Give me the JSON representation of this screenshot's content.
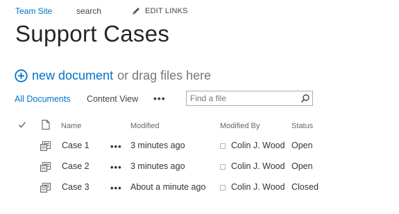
{
  "top_nav": {
    "team_site": "Team Site",
    "search": "search",
    "edit_links": "EDIT LINKS"
  },
  "page": {
    "title": "Support Cases"
  },
  "new_document": {
    "link": "new document",
    "drag_text": "or drag files here"
  },
  "views": {
    "all_documents": "All Documents",
    "content_view": "Content View",
    "more": "•••"
  },
  "find": {
    "placeholder": "Find a file",
    "value": ""
  },
  "table": {
    "headers": {
      "name": "Name",
      "modified": "Modified",
      "modified_by": "Modified By",
      "status": "Status"
    },
    "rows": [
      {
        "name": "Case 1",
        "menu": "•••",
        "modified": "3 minutes ago",
        "modified_by": "Colin J. Wood",
        "status": "Open"
      },
      {
        "name": "Case 2",
        "menu": "•••",
        "modified": "3 minutes ago",
        "modified_by": "Colin J. Wood",
        "status": "Open"
      },
      {
        "name": "Case 3",
        "menu": "•••",
        "modified": "About a minute ago",
        "modified_by": "Colin J. Wood",
        "status": "Closed"
      }
    ]
  },
  "colors": {
    "accent": "#0072c6",
    "text": "#333333",
    "muted": "#777777"
  },
  "icons": {
    "edit": "pencil-icon",
    "new": "plus-circle-icon",
    "search": "magnifier-icon",
    "select_all": "checkmark-icon",
    "doc_type": "document-icon",
    "row_file": "form-file-icon",
    "presence": "presence-icon"
  }
}
